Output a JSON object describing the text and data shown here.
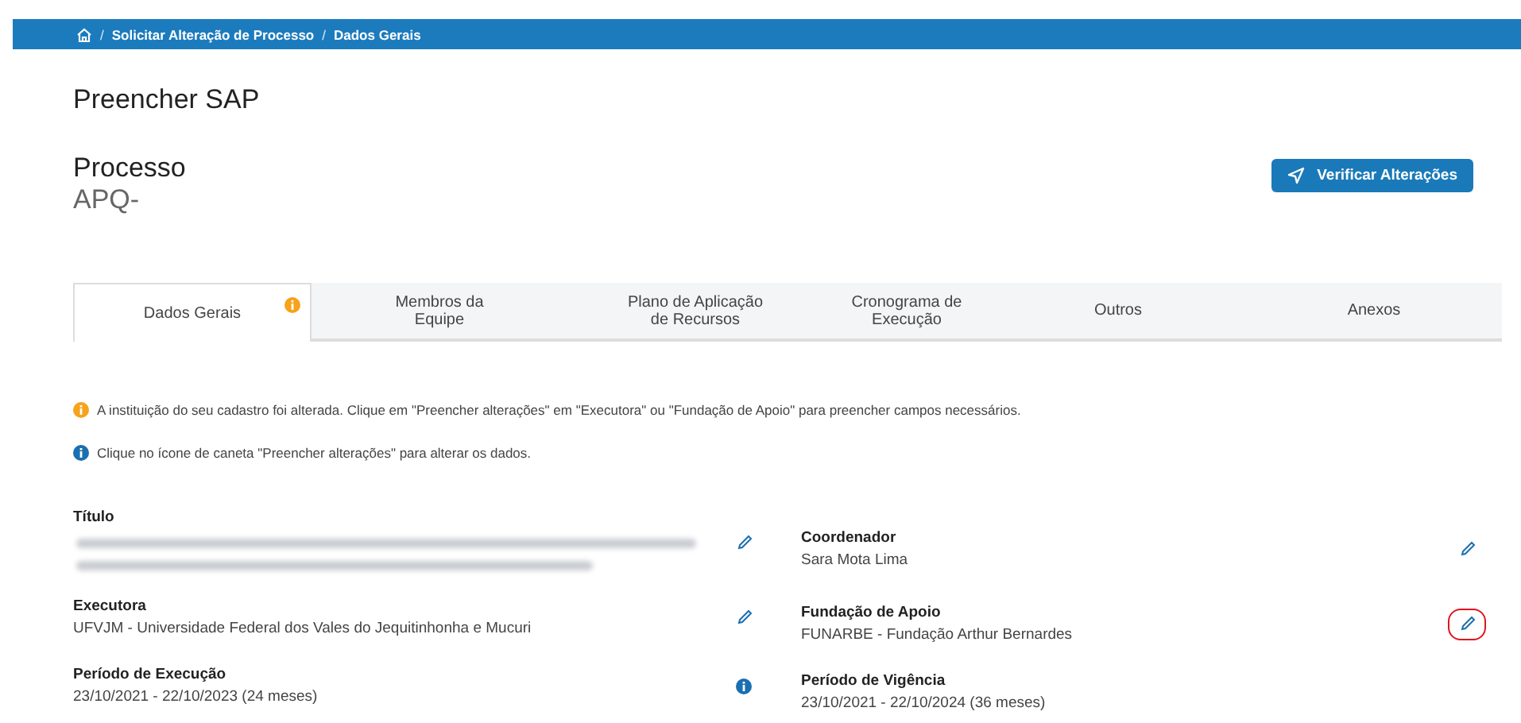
{
  "breadcrumb": {
    "separator": "/",
    "items": [
      "Solicitar Alteração de Processo",
      "Dados Gerais"
    ]
  },
  "page_title": "Preencher SAP",
  "process": {
    "label": "Processo",
    "number": "APQ-"
  },
  "verify_button": "Verificar Alterações",
  "tabs": [
    {
      "label": "Dados Gerais",
      "selected": true,
      "alert": true
    },
    {
      "label": "Membros da Equipe",
      "selected": false,
      "alert": false
    },
    {
      "label": "Plano de Aplicação de Recursos",
      "selected": false,
      "alert": false
    },
    {
      "label": "Cronograma de Execução",
      "selected": false,
      "alert": false
    },
    {
      "label": "Outros",
      "selected": false,
      "alert": false
    },
    {
      "label": "Anexos",
      "selected": false,
      "alert": false
    }
  ],
  "notices": [
    {
      "kind": "warning",
      "text": "A instituição do seu cadastro foi alterada. Clique em \"Preencher alterações\" em \"Executora\" ou \"Fundação de Apoio\" para preencher campos necessários."
    },
    {
      "kind": "info",
      "text": "Clique no ícone de caneta \"Preencher alterações\" para alterar os dados."
    }
  ],
  "fields": [
    {
      "label": "Título",
      "kind": "redacted",
      "editable": true,
      "info": false,
      "highlighted": false
    },
    {
      "label": "Coordenador",
      "kind": "text",
      "value": "Sara Mota Lima",
      "editable": true,
      "info": false,
      "highlighted": false
    },
    {
      "label": "Executora",
      "kind": "text",
      "value": "UFVJM - Universidade Federal dos Vales do Jequitinhonha e Mucuri",
      "editable": true,
      "info": false,
      "highlighted": false
    },
    {
      "label": "Fundação de Apoio",
      "kind": "text",
      "value": "FUNARBE - Fundação Arthur Bernardes",
      "editable": true,
      "info": false,
      "highlighted": true
    },
    {
      "label": "Período de Execução",
      "kind": "text",
      "value": "23/10/2021 - 22/10/2023 (24 meses)",
      "editable": false,
      "info": true,
      "highlighted": false
    },
    {
      "label": "Período de Vigência",
      "kind": "text",
      "value": "23/10/2021 - 22/10/2024 (36 meses)",
      "editable": false,
      "info": false,
      "highlighted": false
    }
  ]
}
